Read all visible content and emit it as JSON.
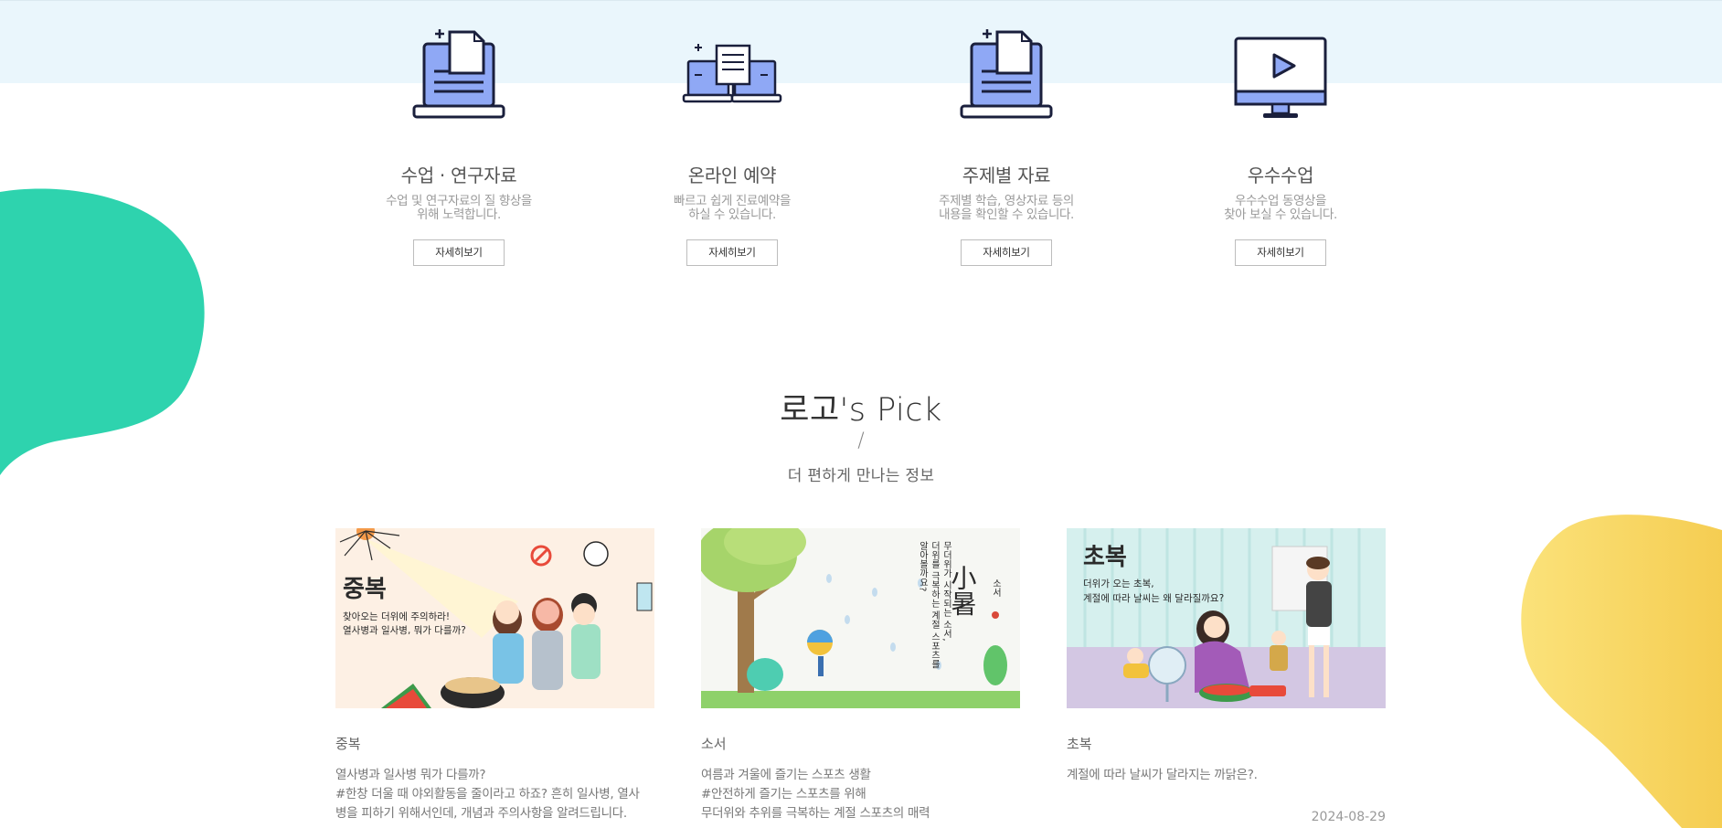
{
  "services": [
    {
      "title": "수업 · 연구자료",
      "desc": "수업 및 연구자료의 질 향상을\n위해 노력합니다.",
      "button": "자세히보기",
      "icon": "laptop-document-icon"
    },
    {
      "title": "온라인 예약",
      "desc": "빠르고 쉽게 진료예약을\n하실 수 있습니다.",
      "button": "자세히보기",
      "icon": "devices-document-icon"
    },
    {
      "title": "주제별 자료",
      "desc": "주제별 학습, 영상자료 등의\n내용을 확인할 수 있습니다.",
      "button": "자세히보기",
      "icon": "laptop-document-icon"
    },
    {
      "title": "우수수업",
      "desc": "우수수업 동영상을\n찾아 보실 수 있습니다.",
      "button": "자세히보기",
      "icon": "monitor-play-icon"
    }
  ],
  "pick": {
    "title": "로고's Pick",
    "slash": "/",
    "subtitle": "더 편하게 만나는 정보"
  },
  "cards": [
    {
      "image": {
        "heading": "중복",
        "line1": "찾아오는 더위에 주의하라!",
        "line2": "열사병과 일사병, 뭐가 다를까?"
      },
      "title": "중복",
      "desc": [
        "열사병과 일사병 뭐가 다를까?",
        "#한창 더울 때 야외활동을 줄이라고 하죠? 흔히 일사병, 열사",
        "병을 피하기 위해서인데, 개념과 주의사항을 알려드립니다."
      ],
      "date": ""
    },
    {
      "image": {
        "heading": "小暑",
        "small": "소서",
        "col1": "무더위가 시작되는 소서,",
        "col2": "더위를 극복하는 계절 스포츠를",
        "col3": "알아볼까요?"
      },
      "title": "소서",
      "desc": [
        "여름과 겨울에 즐기는 스포츠 생활",
        "#안전하게 즐기는 스포츠를 위해",
        "무더위와 추위를 극복하는 계절 스포츠의 매력"
      ],
      "date": ""
    },
    {
      "image": {
        "heading": "초복",
        "line1": "더위가 오는 초복,",
        "line2": "계절에 따라 날씨는 왜 달라질까요?"
      },
      "title": "초복",
      "desc": [
        "계절에 따라 날씨가 달라지는 까닭은?."
      ],
      "date": "2024-08-29"
    }
  ],
  "colors": {
    "band": "#eaf6fc",
    "green_blob": "#2ed3ae",
    "yellow_blob": "#f8d55f",
    "icon_fill": "#8fa8f5",
    "icon_stroke": "#1a1f3c"
  }
}
